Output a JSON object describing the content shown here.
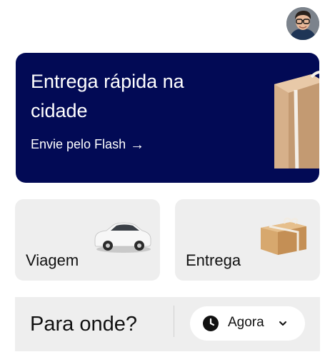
{
  "header": {
    "avatar_icon": "user-avatar-photo"
  },
  "promo": {
    "title": "Entrega rápida na cidade",
    "link_label": "Envie pelo Flash",
    "link_icon": "arrow-right-icon",
    "background_color": "#020a55",
    "image_icon": "package-box-icon"
  },
  "services": [
    {
      "label": "Viagem",
      "image_icon": "car-icon"
    },
    {
      "label": "Entrega",
      "image_icon": "package-box-icon"
    }
  ],
  "search": {
    "placeholder": "Para onde?",
    "time_option": "Agora",
    "clock_icon": "clock-icon",
    "chevron_icon": "chevron-down-icon"
  }
}
